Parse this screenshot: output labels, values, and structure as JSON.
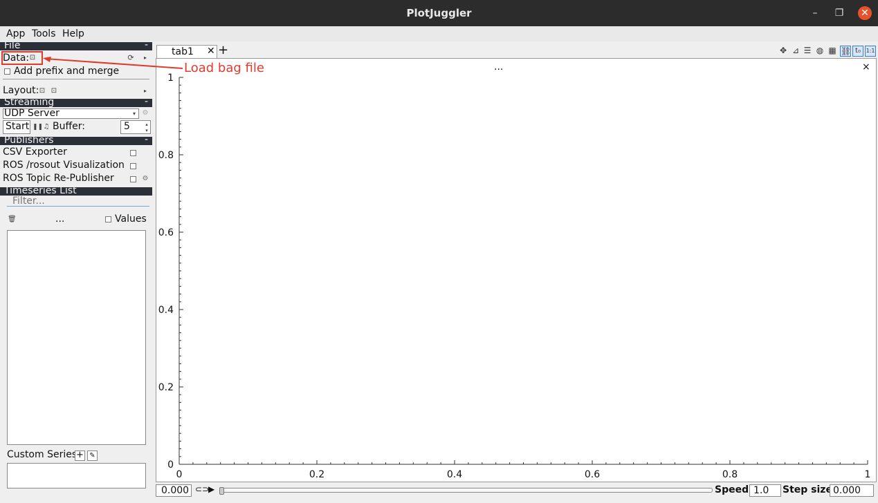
{
  "window": {
    "title": "PlotJuggler"
  },
  "menubar": {
    "items": [
      "App",
      "Tools",
      "Help"
    ]
  },
  "file_section": {
    "header": "File",
    "collapse": "-",
    "data_label": "Data:",
    "add_prefix_label": "Add prefix and merge",
    "layout_label": "Layout:"
  },
  "streaming_section": {
    "header": "Streaming",
    "collapse": "-",
    "source_value": "UDP Server",
    "start_label": "Start",
    "buffer_label": "Buffer:",
    "buffer_value": "5"
  },
  "publishers_section": {
    "header": "Publishers",
    "collapse": "-",
    "items": [
      "CSV Exporter",
      "ROS /rosout Visualization",
      "ROS Topic Re-Publisher"
    ]
  },
  "timeseries_section": {
    "header": "Timeseries List",
    "filter_placeholder": "Filter...",
    "ellipsis": "...",
    "values_label": "Values",
    "custom_series_label": "Custom Series:"
  },
  "tabs": {
    "active": "tab1",
    "add": "+"
  },
  "plot": {
    "title_ellipsis": "...",
    "close": "×",
    "y_ticks": [
      "1",
      "0.8",
      "0.6",
      "0.4",
      "0.2",
      "0"
    ],
    "x_ticks": [
      "0",
      "0.2",
      "0.4",
      "0.6",
      "0.8",
      "1"
    ]
  },
  "bottombar": {
    "time_value": "0.000",
    "speed_label": "Speed:",
    "speed_value": "1.0",
    "step_label": "Step size:",
    "step_value": "0.000"
  },
  "annotation": {
    "text": "Load bag file",
    "color": "#e03a2c"
  },
  "colors": {
    "titlebar": "#2c2c2c",
    "section_header": "#2b2f37",
    "close_button": "#e5532d"
  },
  "icons": [
    "minimize-icon",
    "maximize-icon",
    "close-icon",
    "folder-open-icon",
    "reload-icon",
    "save-icon",
    "gear-icon",
    "pause-icon",
    "bell-icon",
    "trash-icon",
    "move-icon",
    "axes-icon",
    "legend-icon",
    "link-icon",
    "grid-icon",
    "zoom-icon",
    "time-icon",
    "ratio-icon",
    "play-icon",
    "loop-icon"
  ]
}
